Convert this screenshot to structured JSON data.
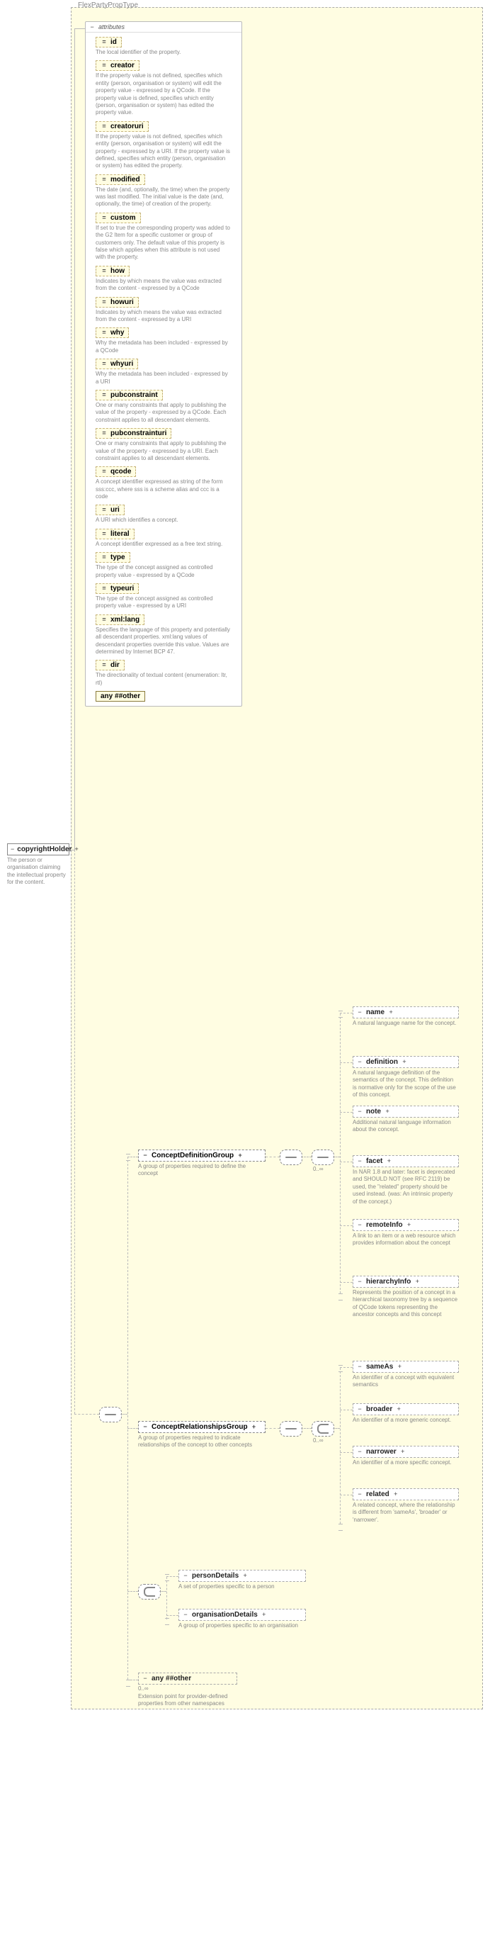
{
  "type_name": "FlexPartyPropType",
  "root": {
    "name": "copyrightHolder",
    "doc": "The person or organisation claiming the intellectual property for the content."
  },
  "attributes_label": "attributes",
  "attributes": [
    {
      "name": "id",
      "doc": "The local identifier of the property."
    },
    {
      "name": "creator",
      "doc": "If the property value is not defined, specifies which entity (person, organisation or system) will edit the property value - expressed by a QCode. If the property value is defined, specifies which entity (person, organisation or system) has edited the property value."
    },
    {
      "name": "creatoruri",
      "doc": "If the property value is not defined, specifies which entity (person, organisation or system) will edit the property - expressed by a URI. If the property value is defined, specifies which entity (person, organisation or system) has edited the property."
    },
    {
      "name": "modified",
      "doc": "The date (and, optionally, the time) when the property was last modified. The initial value is the date (and, optionally, the time) of creation of the property."
    },
    {
      "name": "custom",
      "doc": "If set to true the corresponding property was added to the G2 Item for a specific customer or group of customers only. The default value of this property is false which applies when this attribute is not used with the property."
    },
    {
      "name": "how",
      "doc": "Indicates by which means the value was extracted from the content - expressed by a QCode"
    },
    {
      "name": "howuri",
      "doc": "Indicates by which means the value was extracted from the content - expressed by a URI"
    },
    {
      "name": "why",
      "doc": "Why the metadata has been included - expressed by a QCode"
    },
    {
      "name": "whyuri",
      "doc": "Why the metadata has been included - expressed by a URI"
    },
    {
      "name": "pubconstraint",
      "doc": "One or many constraints that apply to publishing the value of the property - expressed by a QCode. Each constraint applies to all descendant elements."
    },
    {
      "name": "pubconstrainturi",
      "doc": "One or many constraints that apply to publishing the value of the property - expressed by a URI. Each constraint applies to all descendant elements."
    },
    {
      "name": "qcode",
      "doc": "A concept identifier expressed as string of the form sss:ccc, where sss is a scheme alias and ccc is a code"
    },
    {
      "name": "uri",
      "doc": "A URI which identifies a concept."
    },
    {
      "name": "literal",
      "doc": "A concept identifier expressed as a free text string."
    },
    {
      "name": "type",
      "doc": "The type of the concept assigned as controlled property value - expressed by a QCode"
    },
    {
      "name": "typeuri",
      "doc": "The type of the concept assigned as controlled property value - expressed by a URI"
    },
    {
      "name": "xml:lang",
      "doc": "Specifies the language of this property and potentially all descendant properties. xml:lang values of descendant properties override this value. Values are determined by Internet BCP 47."
    },
    {
      "name": "dir",
      "doc": "The directionality of textual content (enumeration: ltr, rtl)"
    }
  ],
  "attr_any": "any  ##other",
  "groups": {
    "definition": {
      "name": "ConceptDefinitionGroup",
      "doc": "A group of properties required to define the concept"
    },
    "relationships": {
      "name": "ConceptRelationshipsGroup",
      "doc": "A group of properties required to indicate relationships of the concept to other concepts"
    }
  },
  "def_children": [
    {
      "name": "name",
      "doc": "A natural language name for the concept."
    },
    {
      "name": "definition",
      "doc": "A natural language definition of the semantics of the concept. This definition is normative only for the scope of the use of this concept."
    },
    {
      "name": "note",
      "doc": "Additional natural language information about the concept."
    },
    {
      "name": "facet",
      "doc": "In NAR 1.8 and later: facet is deprecated and SHOULD NOT (see RFC 2119) be used, the \"related\" property should be used instead. (was: An intrinsic property of the concept.)"
    },
    {
      "name": "remoteInfo",
      "doc": "A link to an item or a web resource which provides information about the concept"
    },
    {
      "name": "hierarchyInfo",
      "doc": "Represents the position of a concept in a hierarchical taxonomy tree by a sequence of QCode tokens representing the ancestor concepts and this concept"
    }
  ],
  "rel_children": [
    {
      "name": "sameAs",
      "doc": "An identifier of a concept with equivalent semantics"
    },
    {
      "name": "broader",
      "doc": "An identifier of a more generic concept."
    },
    {
      "name": "narrower",
      "doc": "An identifier of a more specific concept."
    },
    {
      "name": "related",
      "doc": "A related concept, where the relationship is different from 'sameAs', 'broader' or 'narrower'."
    }
  ],
  "choice_children": [
    {
      "name": "personDetails",
      "doc": "A set of properties specific to a person"
    },
    {
      "name": "organisationDetails",
      "doc": "A group of properties specific to an organisation"
    }
  ],
  "bottom_any": {
    "label": "any  ##other",
    "occur": "0..∞",
    "doc": "Extension point for provider-defined properties from other namespaces"
  },
  "occur_0inf": "0..∞"
}
